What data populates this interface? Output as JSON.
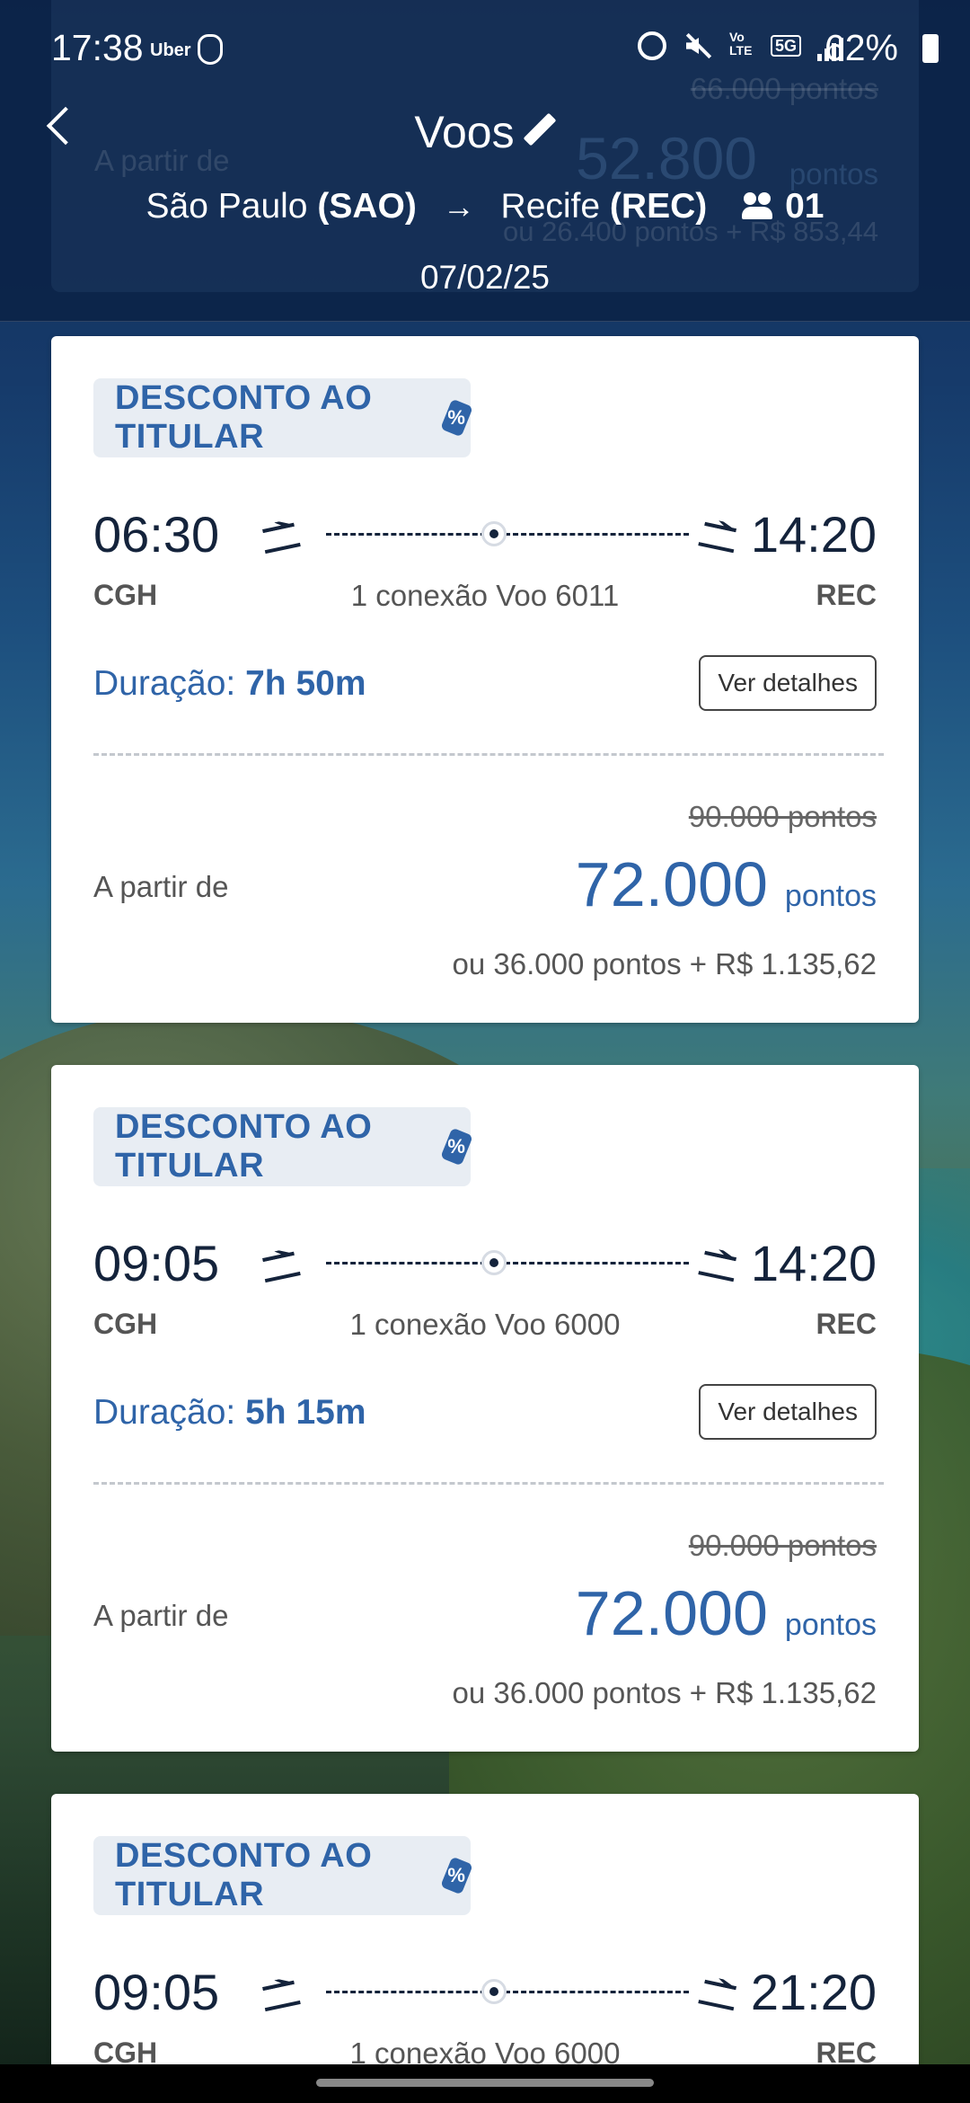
{
  "status_bar": {
    "time": "17:38",
    "app_label": "Uber",
    "battery": "62%"
  },
  "header": {
    "title": "Voos",
    "origin_city": "São Paulo",
    "origin_code": "(SAO)",
    "destination_city": "Recife",
    "destination_code": "(REC)",
    "arrow": "→",
    "passengers": "01",
    "date": "07/02/25"
  },
  "ghost_card": {
    "old_price": "66.000 pontos",
    "from_label": "A partir de",
    "price": "52.800",
    "unit": "pontos",
    "mix": "ou 26.400 pontos + R$ 853,44"
  },
  "flights": [
    {
      "badge": "DESCONTO AO TITULAR",
      "departure": "06:30",
      "arrival": "14:20",
      "origin": "CGH",
      "destination": "REC",
      "connection": "1 conexão Voo 6011",
      "duration_label": "Duração:",
      "duration": "7h 50m",
      "details_label": "Ver detalhes",
      "old_price": "90.000 pontos",
      "from_label": "A partir de",
      "price": "72.000",
      "price_unit": "pontos",
      "mixed_price": "ou 36.000 pontos + R$ 1.135,62"
    },
    {
      "badge": "DESCONTO AO TITULAR",
      "departure": "09:05",
      "arrival": "14:20",
      "origin": "CGH",
      "destination": "REC",
      "connection": "1 conexão Voo 6000",
      "duration_label": "Duração:",
      "duration": "5h 15m",
      "details_label": "Ver detalhes",
      "old_price": "90.000 pontos",
      "from_label": "A partir de",
      "price": "72.000",
      "price_unit": "pontos",
      "mixed_price": "ou 36.000 pontos + R$ 1.135,62"
    },
    {
      "badge": "DESCONTO AO TITULAR",
      "departure": "09:05",
      "arrival": "21:20",
      "origin": "CGH",
      "destination": "REC",
      "connection": "1 conexão Voo 6000"
    }
  ],
  "colors": {
    "header_bg": "#0c2348",
    "accent_blue": "#2f64a8",
    "text_dark": "#14233b",
    "badge_bg": "#e8edf3"
  }
}
